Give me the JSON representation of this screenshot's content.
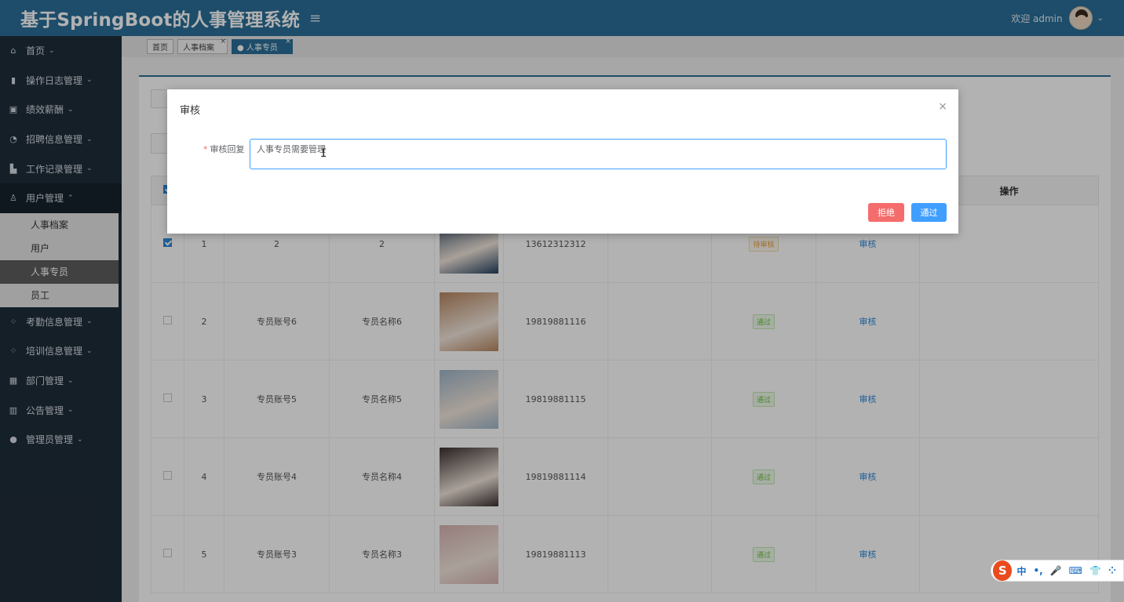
{
  "header": {
    "brand": "基于SpringBoot的人事管理系统",
    "menu_icon": "hamburger-icon",
    "welcome": "欢迎 admin",
    "avatar_icon": "avatar"
  },
  "sidebar": {
    "items_top": [
      {
        "label": "首页",
        "icon": "home-icon",
        "glyph": "⌂"
      },
      {
        "label": "操作日志管理",
        "icon": "book-icon",
        "glyph": "▮"
      },
      {
        "label": "绩效薪酬",
        "icon": "id-card-icon",
        "glyph": "▣"
      },
      {
        "label": "招聘信息管理",
        "icon": "dashboard-icon",
        "glyph": "◔"
      },
      {
        "label": "工作记录管理",
        "icon": "doc-icon",
        "glyph": "▙"
      },
      {
        "label": "用户管理",
        "icon": "user-icon",
        "glyph": "♙"
      }
    ],
    "sub_items": [
      {
        "label": "人事档案"
      },
      {
        "label": "用户"
      },
      {
        "label": "人事专员"
      },
      {
        "label": "员工"
      }
    ],
    "items_bottom": [
      {
        "label": "考勤信息管理",
        "icon": "apps-icon",
        "glyph": "⁘"
      },
      {
        "label": "培训信息管理",
        "icon": "apps-icon",
        "glyph": "⁘"
      },
      {
        "label": "部门管理",
        "icon": "grid-icon",
        "glyph": "▦"
      },
      {
        "label": "公告管理",
        "icon": "chart-icon",
        "glyph": "▥"
      },
      {
        "label": "管理员管理",
        "icon": "circle-icon",
        "glyph": "●"
      }
    ]
  },
  "tabs": [
    {
      "label": "首页"
    },
    {
      "label": "人事档案",
      "close": "×"
    },
    {
      "label": "● 人事专员",
      "close": "×"
    }
  ],
  "table": {
    "header_action": "操作",
    "rows": [
      {
        "idx": "1",
        "account": "2",
        "name": "2",
        "phone": "13612312312",
        "status": "待审核",
        "status_type": "pending",
        "action": "审核",
        "checked": true,
        "photo_color": "#23405f"
      },
      {
        "idx": "2",
        "account": "专员账号6",
        "name": "专员名称6",
        "phone": "19819881116",
        "status": "通过",
        "status_type": "pass",
        "action": "审核",
        "checked": false,
        "photo_color": "#b7865f"
      },
      {
        "idx": "3",
        "account": "专员账号5",
        "name": "专员名称5",
        "phone": "19819881115",
        "status": "通过",
        "status_type": "pass",
        "action": "审核",
        "checked": false,
        "photo_color": "#9fb6c9"
      },
      {
        "idx": "4",
        "account": "专员账号4",
        "name": "专员名称4",
        "phone": "19819881114",
        "status": "通过",
        "status_type": "pass",
        "action": "审核",
        "checked": false,
        "photo_color": "#3a3030"
      },
      {
        "idx": "5",
        "account": "专员账号3",
        "name": "专员名称3",
        "phone": "19819881113",
        "status": "通过",
        "status_type": "pass",
        "action": "审核",
        "checked": false,
        "photo_color": "#d8b3b3"
      }
    ]
  },
  "dialog": {
    "title": "审核",
    "close": "×",
    "field_required": "*",
    "field_label": "审核回复",
    "field_value": "人事专员需要管理",
    "reject_label": "拒绝",
    "pass_label": "通过"
  },
  "ime": {
    "logo": "S",
    "items": [
      "中",
      "•,",
      "🎤",
      "⌨",
      "👕",
      "⁘"
    ]
  },
  "colors": {
    "header": "#2a6f99",
    "sidebar": "#1f2d3a",
    "reject": "#f56c6c",
    "pass": "#409eff"
  }
}
